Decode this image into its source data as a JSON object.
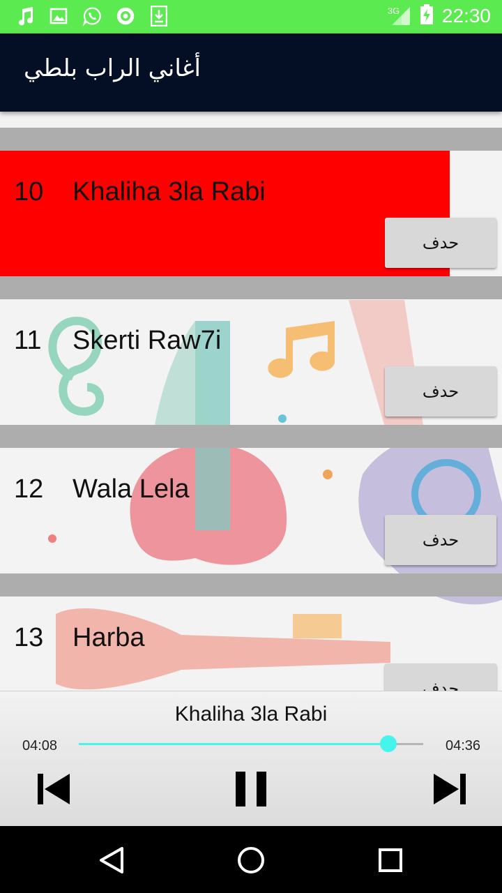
{
  "status_bar": {
    "time": "22:30",
    "network": "3G",
    "notification_icons": [
      "music-note-icon",
      "image-icon",
      "whatsapp-icon",
      "camera-app-icon",
      "download-icon"
    ]
  },
  "app_bar": {
    "title": "أغاني الراب بلطي"
  },
  "songs": [
    {
      "number": "10",
      "title": "Khaliha 3la Rabi",
      "delete_label": "حدف",
      "selected": true
    },
    {
      "number": "11",
      "title": "Skerti Raw7i",
      "delete_label": "حدف",
      "selected": false
    },
    {
      "number": "12",
      "title": "Wala Lela",
      "delete_label": "حدف",
      "selected": false
    },
    {
      "number": "13",
      "title": "Harba",
      "delete_label": "حدف",
      "selected": false
    }
  ],
  "player": {
    "now_playing": "Khaliha 3la Rabi",
    "current_time": "04:08",
    "duration": "04:36",
    "progress_fraction": 0.899,
    "controls": [
      "previous-icon",
      "pause-icon",
      "next-icon"
    ],
    "accent_color": "#45f5ec"
  },
  "nav_bar": {
    "buttons": [
      "back-icon",
      "home-icon",
      "recents-icon"
    ]
  },
  "colors": {
    "status_bar": "#5cea51",
    "app_bar": "#040f26",
    "selected_row": "#ff0000",
    "separator": "#adadad"
  }
}
